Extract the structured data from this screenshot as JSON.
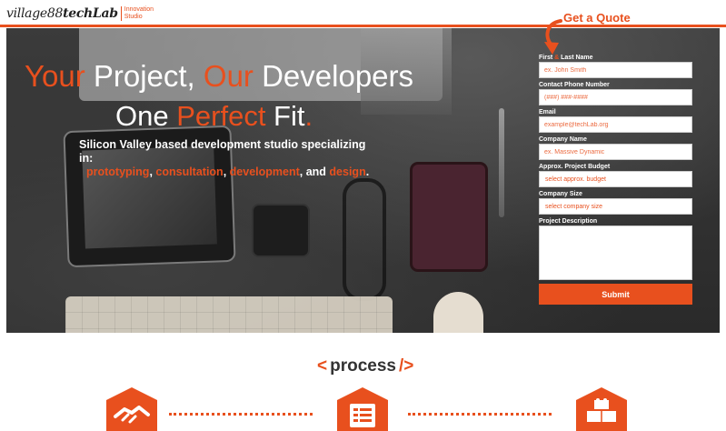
{
  "brand": {
    "name_regular": "village88",
    "name_bold": "techLab",
    "tag_line1": "Innovation",
    "tag_line2": "Studio"
  },
  "quote": {
    "title": "Get a Quote",
    "arrow_icon": "curved-arrow-down-icon"
  },
  "hero": {
    "headline1": {
      "w1": "Your",
      "w2": " Project, ",
      "w3": "Our",
      "w4": " Developers"
    },
    "headline2": {
      "w1": "One ",
      "w2": "Perfect",
      "w3": " Fit",
      "w4": "."
    },
    "subline": {
      "text1": "Silicon Valley based development studio specializing in:",
      "s1": "prototyping",
      "c1": ", ",
      "s2": "consultation",
      "c2": ", ",
      "s3": "development",
      "c3": ", and ",
      "s4": "design",
      "c4": "."
    }
  },
  "form": {
    "name_label_a": "First ",
    "name_label_amp": "&",
    "name_label_b": " Last Name",
    "name_placeholder": "ex. John Smith",
    "phone_label": "Contact Phone Number",
    "phone_placeholder": "(###) ###-####",
    "email_label": "Email",
    "email_placeholder": "example@techLab.org",
    "company_label": "Company Name",
    "company_placeholder": "ex. Massive Dynamic",
    "budget_label": "Approx. Project Budget",
    "budget_value": "select approx. budget",
    "size_label": "Company Size",
    "size_value": "select company size",
    "description_label": "Project Description",
    "submit_label": "Submit"
  },
  "process": {
    "open": "<",
    "title": "process",
    "close": "/>",
    "steps": [
      "handshake-icon",
      "document-list-icon",
      "building-blocks-icon"
    ]
  },
  "colors": {
    "accent": "#e8501e",
    "text_dark": "#333333",
    "white": "#ffffff"
  }
}
